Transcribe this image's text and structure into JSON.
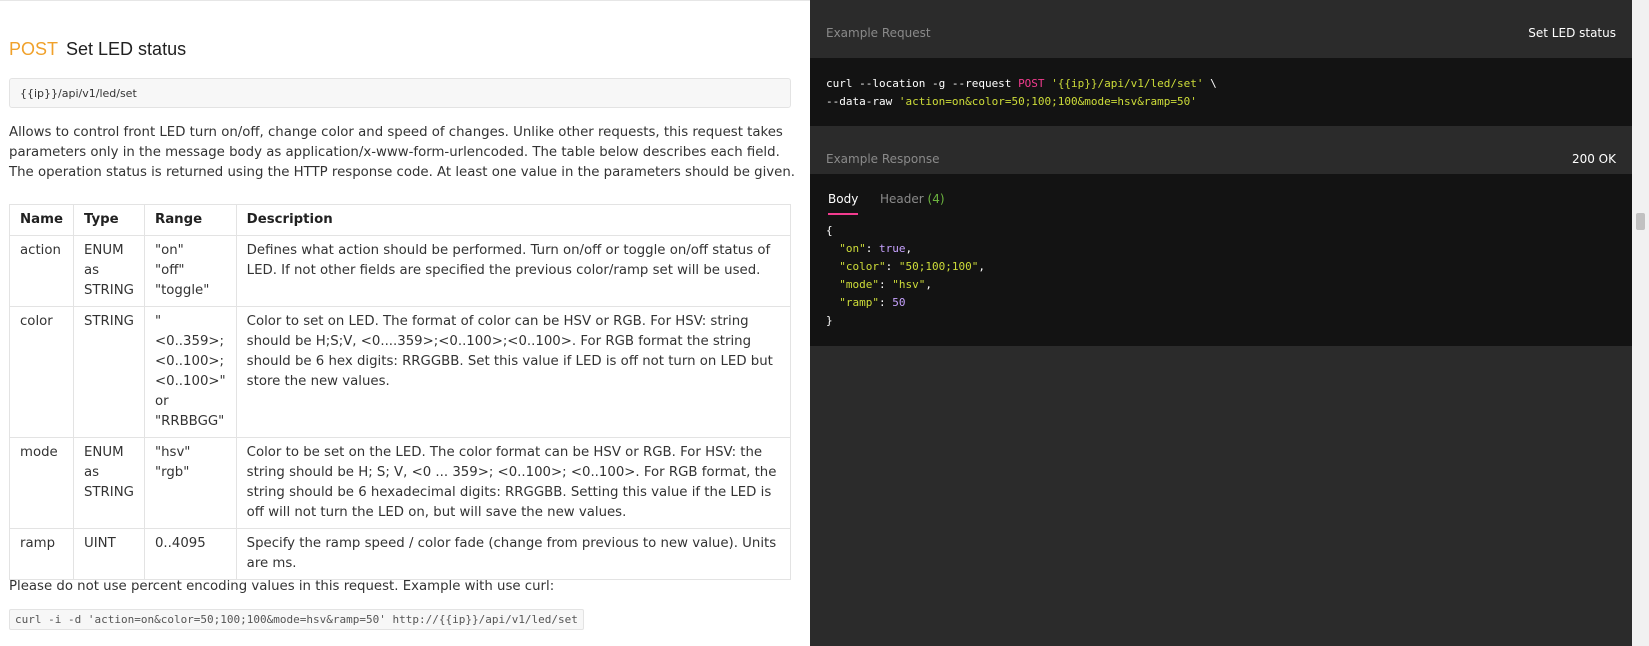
{
  "request": {
    "method": "POST",
    "title": "Set LED status",
    "url": "{{ip}}/api/v1/led/set",
    "description": "Allows to control front LED turn on/off, change color and speed of changes. Unlike other requests, this request takes parameters only in the message body as application/x-www-form-urlencoded. The table below describes each field. The operation status is returned using the HTTP response code. At least one value in the parameters should be given."
  },
  "table": {
    "headers": [
      "Name",
      "Type",
      "Range",
      "Description"
    ],
    "rows": [
      {
        "name": "action",
        "type": [
          "ENUM",
          "as",
          "STRING"
        ],
        "range": [
          "\"on\"",
          "\"off\"",
          "\"toggle\""
        ],
        "description": "Defines what action should be performed. Turn on/off or toggle on/off status of LED. If not other fields are specified the previous color/ramp set will be used."
      },
      {
        "name": "color",
        "type": [
          "STRING"
        ],
        "range": [
          "\"<0..359>;",
          "<0..100>;",
          "<0..100>\"",
          "or",
          "\"RRBBGG\""
        ],
        "description": "Color to set on LED. The format of color can be HSV or RGB. For HSV: string should be H;S;V, <0....359>;<0..100>;<0..100>. For RGB format the string should be 6 hex digits: RRGGBB. Set this value if LED is off not turn on LED but store the new values."
      },
      {
        "name": "mode",
        "type": [
          "ENUM",
          "as",
          "STRING"
        ],
        "range": [
          "\"hsv\"",
          "\"rgb\""
        ],
        "description": "Color to be set on the LED. The color format can be HSV or RGB. For HSV: the string should be H; S; V, <0 ... 359>; <0..100>; <0..100>. For RGB format, the string should be 6 hexadecimal digits: RRGGBB. Setting this value if the LED is off will not turn the LED on, but will save the new values."
      },
      {
        "name": "ramp",
        "type": [
          "UINT"
        ],
        "range": [
          "0..4095"
        ],
        "description": "Specify the ramp speed / color fade (change from previous to new value). Units are ms."
      }
    ]
  },
  "note": "Please do not use percent encoding values in this request. Example with use curl:",
  "curl_example": "curl -i -d 'action=on&color=50;100;100&mode=hsv&ramp=50' http://{{ip}}/api/v1/led/set",
  "example_request": {
    "label": "Example Request",
    "name": "Set LED status",
    "line1_prefix": "curl --location -g --request ",
    "line1_method": "POST",
    "line1_url": "'{{ip}}/api/v1/led/set'",
    "line1_suffix": " \\",
    "line2_prefix": "--data-raw ",
    "line2_data": "'action=on&color=50;100;100&mode=hsv&ramp=50'"
  },
  "example_response": {
    "label": "Example Response",
    "status": "200 OK",
    "tab_body": "Body",
    "tab_header": "Header",
    "tab_header_count": "(4)",
    "json": {
      "open": "{",
      "close": "}",
      "on_key": "\"on\"",
      "on_val": "true",
      "color_key": "\"color\"",
      "color_val": "\"50;100;100\"",
      "mode_key": "\"mode\"",
      "mode_val": "\"hsv\"",
      "ramp_key": "\"ramp\"",
      "ramp_val": "50"
    }
  },
  "colors": {
    "method_post": "#f0a12b",
    "dark_panel": "#2b2b2b",
    "code_bg": "#131313",
    "accent_pink": "#f23c8f",
    "string_green": "#cddc39"
  }
}
